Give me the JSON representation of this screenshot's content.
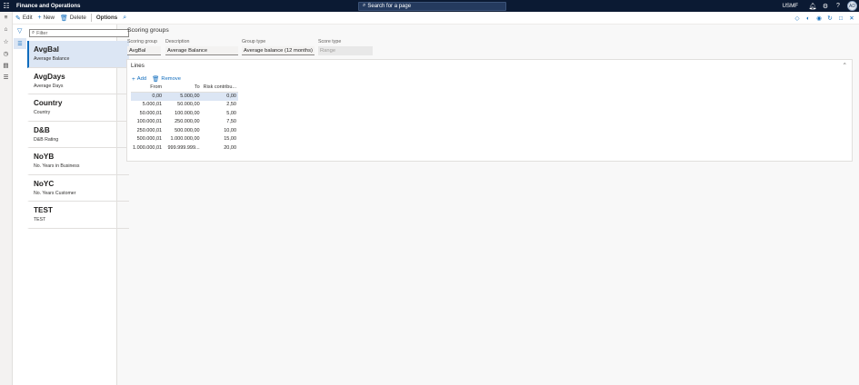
{
  "topbar": {
    "app_title": "Finance and Operations",
    "search_placeholder": "Search for a page",
    "company": "USMF",
    "avatar_initials": "AD"
  },
  "actions": {
    "edit": "Edit",
    "new": "New",
    "delete": "Delete",
    "options": "Options"
  },
  "filter": {
    "placeholder": "Filter"
  },
  "list": {
    "items": [
      {
        "title": "AvgBal",
        "subtitle": "Average Balance"
      },
      {
        "title": "AvgDays",
        "subtitle": "Average Days"
      },
      {
        "title": "Country",
        "subtitle": "Country"
      },
      {
        "title": "D&B",
        "subtitle": "D&B Rating"
      },
      {
        "title": "NoYB",
        "subtitle": "No. Years in Business"
      },
      {
        "title": "NoYC",
        "subtitle": "No. Years Customer"
      },
      {
        "title": "TEST",
        "subtitle": "TEST"
      }
    ]
  },
  "page": {
    "title": "Scoring groups",
    "fields": {
      "scoring_group": {
        "label": "Scoring group",
        "value": "AvgBal"
      },
      "description": {
        "label": "Description",
        "value": "Average Balance"
      },
      "group_type": {
        "label": "Group type",
        "value": "Average balance (12 months)"
      },
      "score_type": {
        "label": "Score type",
        "value": "Range"
      }
    }
  },
  "lines": {
    "title": "Lines",
    "add_label": "Add",
    "remove_label": "Remove",
    "columns": [
      "From",
      "To",
      "Risk contribu..."
    ],
    "rows": [
      [
        "0,00",
        "5.000,00",
        "0,00"
      ],
      [
        "5.000,01",
        "50.000,00",
        "2,50"
      ],
      [
        "50.000,01",
        "100.000,00",
        "5,00"
      ],
      [
        "100.000,01",
        "250.000,00",
        "7,50"
      ],
      [
        "250.000,01",
        "500.000,00",
        "10,00"
      ],
      [
        "500.000,01",
        "1.000.000,00",
        "15,00"
      ],
      [
        "1.000.000,01",
        "999.999.999...",
        "20,00"
      ]
    ]
  }
}
